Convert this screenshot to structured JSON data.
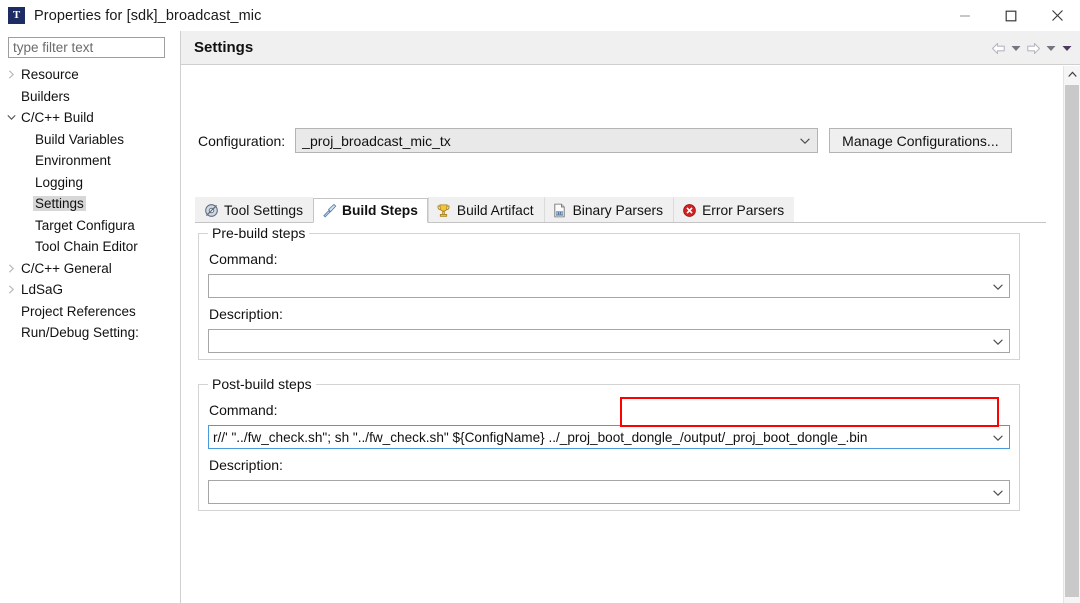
{
  "window": {
    "title": "Properties for [sdk]_broadcast_mic",
    "app_icon": "T",
    "minimize_label": "—",
    "maximize_label": "□",
    "close_label": "✕"
  },
  "sidebar": {
    "filter_placeholder": "type filter text",
    "items": [
      {
        "label": "Resource",
        "level": 0,
        "arrow": "collapsed",
        "selected": false
      },
      {
        "label": "Builders",
        "level": 0,
        "arrow": "none",
        "selected": false
      },
      {
        "label": "C/C++ Build",
        "level": 0,
        "arrow": "expanded",
        "selected": false
      },
      {
        "label": "Build Variables",
        "level": 1,
        "arrow": "none",
        "selected": false
      },
      {
        "label": "Environment",
        "level": 1,
        "arrow": "none",
        "selected": false
      },
      {
        "label": "Logging",
        "level": 1,
        "arrow": "none",
        "selected": false
      },
      {
        "label": "Settings",
        "level": 1,
        "arrow": "none",
        "selected": true
      },
      {
        "label": "Target Configura",
        "level": 1,
        "arrow": "none",
        "selected": false
      },
      {
        "label": "Tool Chain Editor",
        "level": 1,
        "arrow": "none",
        "selected": false
      },
      {
        "label": "C/C++ General",
        "level": 0,
        "arrow": "collapsed",
        "selected": false
      },
      {
        "label": "LdSaG",
        "level": 0,
        "arrow": "collapsed",
        "selected": false
      },
      {
        "label": "Project References",
        "level": 0,
        "arrow": "none",
        "selected": false
      },
      {
        "label": "Run/Debug Setting:",
        "level": 0,
        "arrow": "none",
        "selected": false
      }
    ]
  },
  "header": {
    "title": "Settings",
    "nav": {
      "back": "back-arrow",
      "back_menu": "chevron-down",
      "forward": "forward-arrow",
      "forward_menu": "chevron-down",
      "view_menu": "chevron-down"
    }
  },
  "configuration": {
    "label": "Configuration:",
    "value": "_proj_broadcast_mic_tx",
    "manage_button": "Manage Configurations..."
  },
  "tabs": [
    {
      "label": "Tool Settings",
      "icon": "tool-settings-icon",
      "active": false
    },
    {
      "label": "Build Steps",
      "icon": "build-steps-icon",
      "active": true
    },
    {
      "label": "Build Artifact",
      "icon": "trophy-icon",
      "active": false
    },
    {
      "label": "Binary Parsers",
      "icon": "binary-file-icon",
      "active": false
    },
    {
      "label": "Error Parsers",
      "icon": "error-circle-icon",
      "active": false
    }
  ],
  "prebuild": {
    "title": "Pre-build steps",
    "command_label": "Command:",
    "command_value": "",
    "description_label": "Description:",
    "description_value": ""
  },
  "postbuild": {
    "title": "Post-build steps",
    "command_label": "Command:",
    "command_value": "r//' \"../fw_check.sh\"; sh \"../fw_check.sh\" ${ConfigName} ../_proj_boot_dongle_/output/_proj_boot_dongle_.bin",
    "description_label": "Description:",
    "description_value": ""
  },
  "annotation": {
    "highlight_color": "#ff0000",
    "highlights": "post-build-command-path"
  },
  "colors": {
    "accent": "#1d2d63",
    "focus_border": "#4a9bdc",
    "selection": "#d7d7d7",
    "header_bg": "#f0f0f0"
  }
}
